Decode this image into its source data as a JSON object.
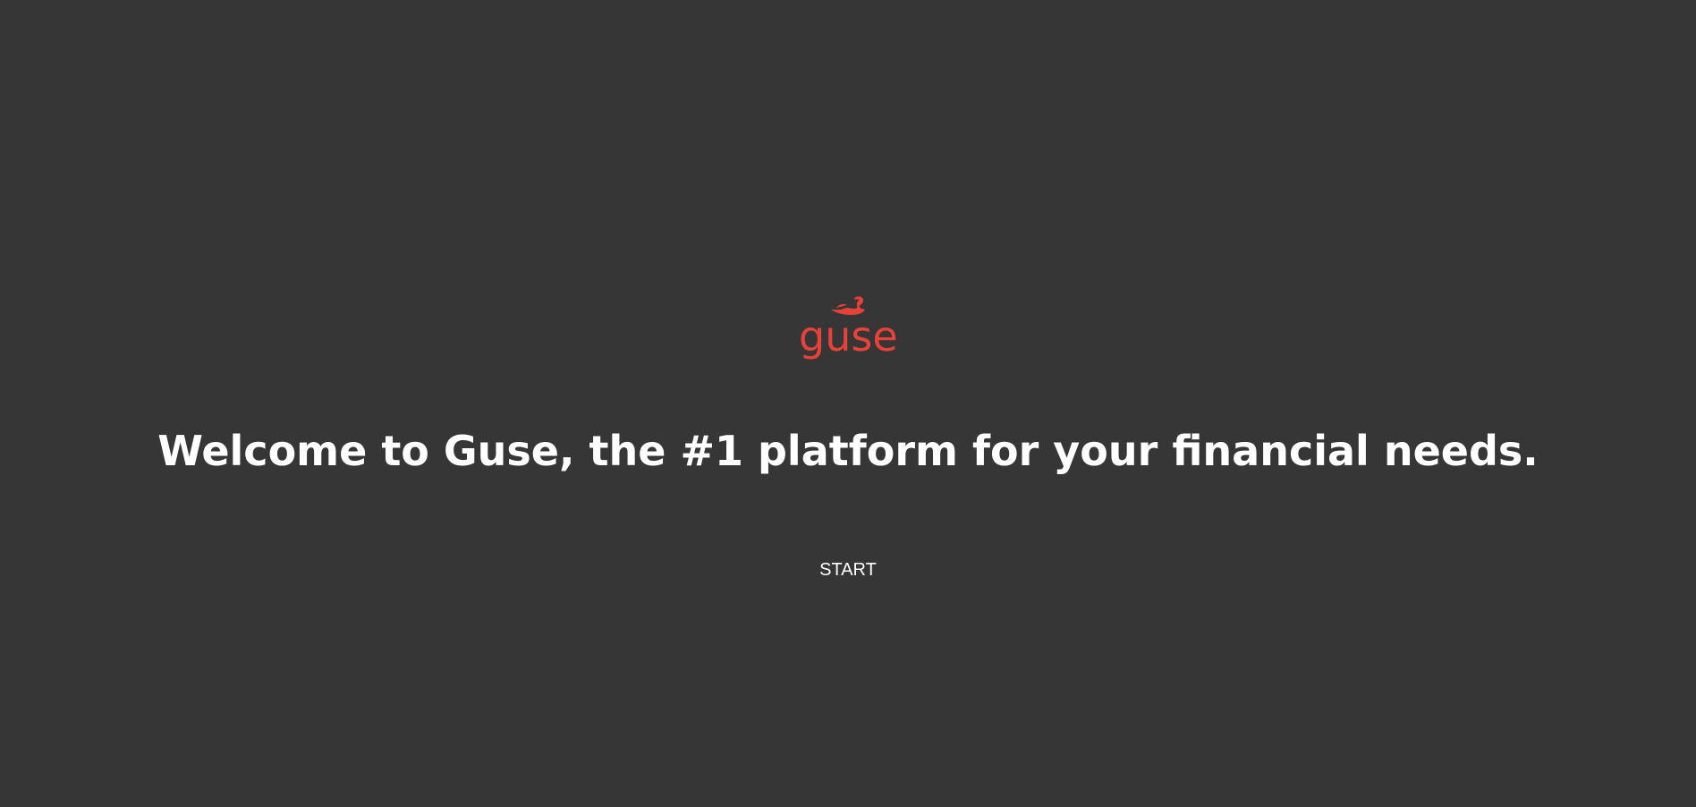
{
  "brand": {
    "logo_text": "guse",
    "logo_icon": "swan-icon",
    "accent_color": "#e8413a"
  },
  "hero": {
    "headline": "Welcome to Guse, the #1 platform for your financial needs.",
    "start_label": "START"
  },
  "colors": {
    "background": "#363636",
    "text": "#ffffff"
  }
}
